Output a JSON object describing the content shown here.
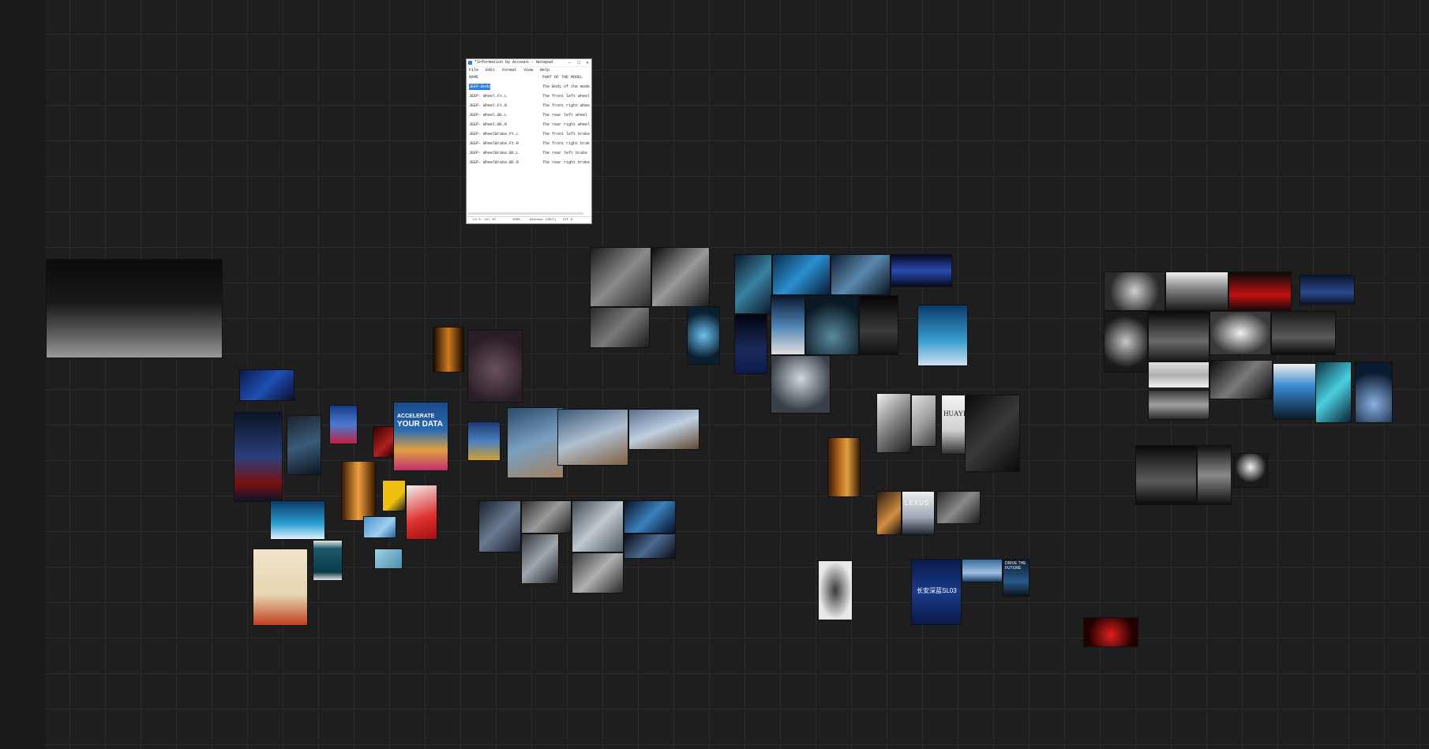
{
  "canvas": {
    "background": "#1e1e1e",
    "grid_color": "#2c2c2c"
  },
  "notepad": {
    "title": "*Information by Account - Notepad",
    "controls": [
      "–",
      "□",
      "✕"
    ],
    "menu": [
      "File",
      "Edit",
      "Format",
      "View",
      "Help"
    ],
    "header_col1": "NAME",
    "header_col2": "PART OF THE MODEL",
    "rows": [
      {
        "name": "JEEP-Body",
        "part": "The Body of the model"
      },
      {
        "name": "JEEP- Wheel.Ft.L",
        "part": "The front left wheel"
      },
      {
        "name": "JEEP- Wheel.Ft.R",
        "part": "The front right wheel"
      },
      {
        "name": "JEEP- Wheel.Bk.L",
        "part": "The rear left wheel"
      },
      {
        "name": "JEEP- Wheel.Bk.R",
        "part": "The rear right wheel"
      },
      {
        "name": "JEEP- WheelBrake.Ft.L",
        "part": "The front left brake"
      },
      {
        "name": "JEEP- WheelBrake.Ft.R",
        "part": "The front right brake"
      },
      {
        "name": "JEEP- WheelBrake.Bk.L",
        "part": "The rear left brake c"
      },
      {
        "name": "JEEP- WheelBrake.Bk.R",
        "part": "The rear right brake"
      }
    ],
    "status": {
      "position": "Ln 2, Col 10",
      "zoom": "100%",
      "line_ending": "Windows (CRLF)",
      "encoding": "UTF-8"
    }
  },
  "tile_texts": {
    "your_data_line1": "ACCELERATE",
    "your_data_line2": "YOUR DATA",
    "huayra": "HUAYRA",
    "lexus": "LEXUS",
    "chinese_title": "长安深蓝SL03",
    "drive_future": "DRIVE THE FUTURE"
  },
  "tiles": [
    {
      "id": "car-showroom-large",
      "bg": "linear-gradient(180deg,#0b0b0b 0%,#1a1a1a 45%,#5a5a5a 75%,#9a9a9a 100%)"
    },
    {
      "id": "blue-speed",
      "bg": "linear-gradient(135deg,#0a1a4a,#1f4fb5 50%,#0a1030)"
    },
    {
      "id": "orange-tunnel-small",
      "bg": "linear-gradient(90deg,#1a0a00,#d07a20 50%,#1a0a00)"
    },
    {
      "id": "motorbike-spiral",
      "bg": "radial-gradient(circle at 50% 55%,#6a5060,#2a1e26 70%)"
    },
    {
      "id": "f1-poster",
      "bg": "linear-gradient(180deg,#0c1428,#2a3f7a 50%,#7a1010 80%,#0c1428)"
    },
    {
      "id": "blue-ribbon-poster",
      "bg": "linear-gradient(160deg,#1a2430,#3a5a78 50%,#0e1620)"
    },
    {
      "id": "blue-car-poster",
      "bg": "linear-gradient(180deg,#1a3a8a,#4a7ad0 50%,#c02040)"
    },
    {
      "id": "red-car-small",
      "bg": "linear-gradient(135deg,#300,#b02020 60%,#200)"
    },
    {
      "id": "your-data-poster",
      "bg": "linear-gradient(180deg,#1a4a8a,#2a6ab0 40%,#e0a040 70%,#c03070)"
    },
    {
      "id": "racing-poster",
      "bg": "linear-gradient(180deg,#1a3a70,#4a80c0 50%,#d0a030)"
    },
    {
      "id": "blue-wave-car",
      "bg": "linear-gradient(180deg,#0a3a6a,#2aa0d0 60%,#e0f0ff)"
    },
    {
      "id": "orange-light-poster",
      "bg": "linear-gradient(90deg,#3a1a00,#f0a040 50%,#3a1a00)"
    },
    {
      "id": "yellow-s-poster",
      "bg": "linear-gradient(135deg,#f0c010,#f0c010 60%,#202020)"
    },
    {
      "id": "red-curve-poster",
      "bg": "linear-gradient(160deg,#f0f0f0,#e03030 60%,#a01010)"
    },
    {
      "id": "blue-splash-small",
      "bg": "linear-gradient(135deg,#4a90d0,#a0d0f0 60%,#2060a0)"
    },
    {
      "id": "cream-poster",
      "bg": "linear-gradient(180deg,#f0e4cc,#e8d6b0 60%,#c04020)"
    },
    {
      "id": "teal-framed",
      "bg": "linear-gradient(180deg,#e8e8e8,#1a5a6a 20%,#0a3a4a 80%,#e8e8e8)"
    },
    {
      "id": "light-blue-small",
      "bg": "linear-gradient(135deg,#a0d0e0,#4a90b0)"
    },
    {
      "id": "sky-car-1",
      "bg": "linear-gradient(160deg,#2a4a6a,#7aa0c0 50%,#a08060)"
    },
    {
      "id": "sky-car-2",
      "bg": "linear-gradient(160deg,#3a5a7a,#b0c0d0 50%,#806040)"
    },
    {
      "id": "sky-car-3",
      "bg": "linear-gradient(160deg,#5a7090,#c0d0e0 50%,#604830)"
    },
    {
      "id": "bw-car-1",
      "bg": "linear-gradient(135deg,#1a1a1a,#8a8a8a 50%,#2a2a2a)"
    },
    {
      "id": "bw-car-2",
      "bg": "linear-gradient(135deg,#0a0a0a,#9a9a9a 50%,#1a1a1a)"
    },
    {
      "id": "bw-car-3",
      "bg": "linear-gradient(135deg,#2a2a2a,#7a7a7a 50%,#1a1a1a)"
    },
    {
      "id": "blue-tunnel-small",
      "bg": "radial-gradient(circle,#6ac0f0,#0a2030 70%)"
    },
    {
      "id": "dark-teal-1",
      "bg": "linear-gradient(135deg,#0a1a2a,#3a80a0 50%,#0a1a2a)"
    },
    {
      "id": "dark-teal-2",
      "bg": "linear-gradient(135deg,#0a2a4a,#2a90d0 50%,#0a1a3a)"
    },
    {
      "id": "dark-teal-3",
      "bg": "linear-gradient(135deg,#102030,#5a8ab0 50%,#0a1420)"
    },
    {
      "id": "dark-teal-4",
      "bg": "linear-gradient(180deg,#050a20,#2a4ab0 50%,#050a20)"
    },
    {
      "id": "dark-road",
      "bg": "linear-gradient(180deg,#020410,#1a2a5a 60%,#0a1a4a)"
    },
    {
      "id": "light-road",
      "bg": "linear-gradient(180deg,#0a1830,#4a80b0 50%,#e0e0e0)"
    },
    {
      "id": "dark-car-front",
      "bg": "radial-gradient(circle at 50% 70%,#5a8aa0,#0a1a24 70%)"
    },
    {
      "id": "dark-poster",
      "bg": "linear-gradient(180deg,#050505,#3a3a3a 60%,#101010)"
    },
    {
      "id": "blue-stage",
      "bg": "linear-gradient(180deg,#0a3a6a,#3aa0d0 60%,#d0e0f0)"
    },
    {
      "id": "silver-car-front",
      "bg": "radial-gradient(circle at 50% 40%,#d0d8e0,#3a4048 70%)"
    },
    {
      "id": "white-car-1",
      "bg": "linear-gradient(135deg,#f0f0f0,#808080 50%,#202020)"
    },
    {
      "id": "white-car-2",
      "bg": "linear-gradient(135deg,#e0e0e0,#a0a0a0 50%,#404040)"
    },
    {
      "id": "huayra-poster",
      "bg": "linear-gradient(180deg,#f4f4f4,#d0d0d0 60%,#303030)"
    },
    {
      "id": "black-car-poster",
      "bg": "linear-gradient(135deg,#0a0a0a,#3a3a3a 50%,#0a0a0a)"
    },
    {
      "id": "orange-door",
      "bg": "linear-gradient(90deg,#3a1a08,#c07020 40%,#e0a040 60%,#3a1a08)"
    },
    {
      "id": "orange-car-small",
      "bg": "linear-gradient(135deg,#2a1a10,#d09040 60%,#1a1010)"
    },
    {
      "id": "lexus-poster",
      "bg": "linear-gradient(180deg,#f0f0f0,#a0a8b8 60%,#202830)"
    },
    {
      "id": "interior-dark",
      "bg": "linear-gradient(135deg,#2a2a2a,#8a8a8a 50%,#1a1a1a)"
    },
    {
      "id": "topdown-car",
      "bg": "radial-gradient(ellipse at 50% 50%,#3a3a3a,#e8e8e8 70%)"
    },
    {
      "id": "chinese-poster",
      "bg": "linear-gradient(180deg,#0a1a4a,#1a3a8a 50%,#0a1a4a)"
    },
    {
      "id": "blue-car-wide",
      "bg": "linear-gradient(180deg,#3a6aa0,#a0c0e0 60%,#1a3a6a)"
    },
    {
      "id": "drive-future",
      "bg": "linear-gradient(180deg,#0a1a2a,#2a5a8a 60%,#0a1420)"
    },
    {
      "id": "cockpit-1",
      "bg": "linear-gradient(135deg,#1a2030,#6a7a90 50%,#1a2030)"
    },
    {
      "id": "cockpit-2",
      "bg": "linear-gradient(135deg,#303030,#9a9a9a 50%,#202020)"
    },
    {
      "id": "cockpit-3",
      "bg": "linear-gradient(135deg,#404850,#c0c8d0 50%,#505860)"
    },
    {
      "id": "cockpit-4",
      "bg": "linear-gradient(135deg,#0a1020,#3a80c0 50%,#0a1020)"
    },
    {
      "id": "cockpit-5",
      "bg": "linear-gradient(135deg,#303438,#a0a8b0 50%,#202428)"
    },
    {
      "id": "cockpit-6",
      "bg": "linear-gradient(135deg,#383a3c,#b0b0b0 50%,#282828)"
    },
    {
      "id": "cockpit-7",
      "bg": "linear-gradient(135deg,#0a0c14,#4a6a90 50%,#0a0c14)"
    },
    {
      "id": "silver-sculpture",
      "bg": "radial-gradient(circle,#d0d0d0,#2a2a2a 70%)"
    },
    {
      "id": "white-light-room",
      "bg": "linear-gradient(180deg,#f0f0f0,#8a8a8a 40%,#1a1a1a)"
    },
    {
      "id": "red-car-dark",
      "bg": "linear-gradient(180deg,#0a0a0a,#c01010 60%,#1a0a0a)"
    },
    {
      "id": "navy-car",
      "bg": "linear-gradient(180deg,#0a1430,#2a4a8a 60%,#0a1430)"
    },
    {
      "id": "silver-round",
      "bg": "radial-gradient(circle,#c8c8c8,#1a1a1a 70%)"
    },
    {
      "id": "dark-car-lit",
      "bg": "linear-gradient(180deg,#0a0a0a,#6a6a6a 60%,#1a1a1a)"
    },
    {
      "id": "sketch-car",
      "bg": "radial-gradient(ellipse,#f0f0f0,#3a3a3a 70%)"
    },
    {
      "id": "grey-room-car",
      "bg": "linear-gradient(180deg,#1a1a1a,#5a5a5a 60%,#0a0a0a)"
    },
    {
      "id": "white-car-wide",
      "bg": "linear-gradient(180deg,#e0e0e0,#b0b0b0 50%,#f0f0f0)"
    },
    {
      "id": "dark-silver-car",
      "bg": "linear-gradient(135deg,#0a0a0a,#7a7a7a 50%,#0a0a0a)"
    },
    {
      "id": "blue-light-car",
      "bg": "linear-gradient(180deg,#f0f0f0,#3a8ad0 40%,#0a1a2a)"
    },
    {
      "id": "teal-marble",
      "bg": "linear-gradient(135deg,#0a3040,#4ad0e0 50%,#0a2030)"
    },
    {
      "id": "blue-glow-car",
      "bg": "radial-gradient(circle at 50% 70%,#8ab0e0,#0a1a30 70%)"
    },
    {
      "id": "grey-car-wide",
      "bg": "linear-gradient(180deg,#3a3a3a,#a0a0a0 50%,#2a2a2a)"
    },
    {
      "id": "black-car-1",
      "bg": "linear-gradient(180deg,#0a0a0a,#5a5a5a 60%,#0a0a0a)"
    },
    {
      "id": "black-car-2",
      "bg": "linear-gradient(180deg,#101010,#8a8a8a 50%,#101010)"
    },
    {
      "id": "white-spot-car",
      "bg": "radial-gradient(circle at 50% 40%,#f0f0f0,#1a1a1a 60%)"
    },
    {
      "id": "red-tunnel",
      "bg": "radial-gradient(circle at 50% 60%,#e02020,#200 70%)"
    }
  ]
}
